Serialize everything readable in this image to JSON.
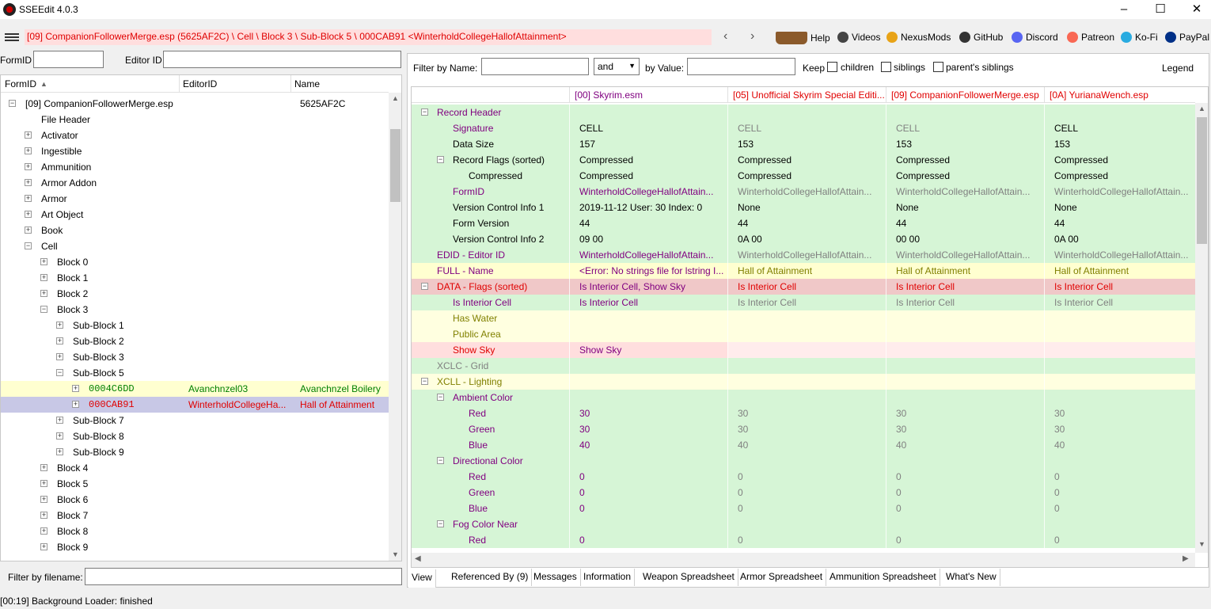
{
  "window": {
    "title": "SSEEdit 4.0.3",
    "minimize": "–",
    "maximize": "☐",
    "close": "✕"
  },
  "toolbar": {
    "path": "[09] CompanionFollowerMerge.esp (5625AF2C) \\ Cell \\ Block 3 \\ Sub-Block 5 \\ 000CAB91 <WinterholdCollegeHallofAttainment>",
    "back": "‹",
    "forward": "›",
    "links": [
      {
        "label": "Help",
        "icon": "book-icon"
      },
      {
        "label": "Videos",
        "icon": "gp-icon"
      },
      {
        "label": "NexusMods",
        "icon": "nexus-icon"
      },
      {
        "label": "GitHub",
        "icon": "github-icon"
      },
      {
        "label": "Discord",
        "icon": "discord-icon"
      },
      {
        "label": "Patreon",
        "icon": "patreon-icon"
      },
      {
        "label": "Ko-Fi",
        "icon": "kofi-icon"
      },
      {
        "label": "PayPal",
        "icon": "paypal-icon"
      }
    ]
  },
  "left": {
    "formid_label": "FormID",
    "editorid_label": "Editor ID",
    "formid_value": "",
    "editorid_value": "",
    "columns": [
      "FormID",
      "EditorID",
      "Name"
    ],
    "sort_indicator": "▲",
    "plugin": {
      "name": "[09] CompanionFollowerMerge.esp",
      "crc": "5625AF2C"
    },
    "tree": [
      {
        "indent": 1,
        "exp": "",
        "text": "File Header"
      },
      {
        "indent": 1,
        "exp": "+",
        "text": "Activator"
      },
      {
        "indent": 1,
        "exp": "+",
        "text": "Ingestible"
      },
      {
        "indent": 1,
        "exp": "+",
        "text": "Ammunition"
      },
      {
        "indent": 1,
        "exp": "+",
        "text": "Armor Addon"
      },
      {
        "indent": 1,
        "exp": "+",
        "text": "Armor"
      },
      {
        "indent": 1,
        "exp": "+",
        "text": "Art Object"
      },
      {
        "indent": 1,
        "exp": "+",
        "text": "Book"
      },
      {
        "indent": 1,
        "exp": "−",
        "text": "Cell"
      },
      {
        "indent": 2,
        "exp": "+",
        "text": "Block 0"
      },
      {
        "indent": 2,
        "exp": "+",
        "text": "Block 1"
      },
      {
        "indent": 2,
        "exp": "+",
        "text": "Block 2"
      },
      {
        "indent": 2,
        "exp": "−",
        "text": "Block 3"
      },
      {
        "indent": 3,
        "exp": "+",
        "text": "Sub-Block 1"
      },
      {
        "indent": 3,
        "exp": "+",
        "text": "Sub-Block 2"
      },
      {
        "indent": 3,
        "exp": "+",
        "text": "Sub-Block 3"
      },
      {
        "indent": 3,
        "exp": "−",
        "text": "Sub-Block 5"
      },
      {
        "indent": 4,
        "exp": "+",
        "text": "0004C6DD",
        "editorid": "Avanchnzel03",
        "name": "Avanchnzel Boilery",
        "style": "green"
      },
      {
        "indent": 4,
        "exp": "+",
        "text": "000CAB91",
        "editorid": "WinterholdCollegeHa...",
        "name": "Hall of Attainment",
        "style": "selected"
      },
      {
        "indent": 3,
        "exp": "+",
        "text": "Sub-Block 7"
      },
      {
        "indent": 3,
        "exp": "+",
        "text": "Sub-Block 8"
      },
      {
        "indent": 3,
        "exp": "+",
        "text": "Sub-Block 9"
      },
      {
        "indent": 2,
        "exp": "+",
        "text": "Block 4"
      },
      {
        "indent": 2,
        "exp": "+",
        "text": "Block 5"
      },
      {
        "indent": 2,
        "exp": "+",
        "text": "Block 6"
      },
      {
        "indent": 2,
        "exp": "+",
        "text": "Block 7"
      },
      {
        "indent": 2,
        "exp": "+",
        "text": "Block 8"
      },
      {
        "indent": 2,
        "exp": "+",
        "text": "Block 9"
      }
    ],
    "filter_label": "Filter by filename:",
    "filter_value": ""
  },
  "right": {
    "filter_name_label": "Filter by Name:",
    "filter_name_value": "",
    "and_value": "and",
    "by_value_label": "by Value:",
    "by_value_value": "",
    "keep_label": "Keep",
    "children_label": "children",
    "siblings_label": "siblings",
    "parents_siblings_label": "parent's siblings",
    "legend_label": "Legend",
    "plugins": [
      "[00] Skyrim.esm",
      "[05] Unofficial Skyrim Special Editi...",
      "[09] CompanionFollowerMerge.esp",
      "[0A] YurianaWench.esp"
    ],
    "rows": [
      {
        "indent": 0,
        "exp": "−",
        "label": "Record Header",
        "bg": "green",
        "lc": "purple",
        "vals": [
          "",
          "",
          "",
          ""
        ],
        "vc": [
          "black",
          "black",
          "black",
          "black"
        ]
      },
      {
        "indent": 1,
        "exp": "",
        "label": "Signature",
        "bg": "green",
        "lc": "purple",
        "vals": [
          "CELL",
          "CELL",
          "CELL",
          "CELL"
        ],
        "vc": [
          "black",
          "gray",
          "gray",
          "black"
        ]
      },
      {
        "indent": 1,
        "exp": "",
        "label": "Data Size",
        "bg": "green",
        "lc": "black",
        "vals": [
          "157",
          "153",
          "153",
          "153"
        ],
        "vc": [
          "black",
          "black",
          "black",
          "black"
        ]
      },
      {
        "indent": 1,
        "exp": "−",
        "label": "Record Flags (sorted)",
        "bg": "green",
        "lc": "black",
        "vals": [
          "Compressed",
          "Compressed",
          "Compressed",
          "Compressed"
        ],
        "vc": [
          "black",
          "black",
          "black",
          "black"
        ]
      },
      {
        "indent": 2,
        "exp": "",
        "label": "Compressed",
        "bg": "green",
        "lc": "black",
        "vals": [
          "Compressed",
          "Compressed",
          "Compressed",
          "Compressed"
        ],
        "vc": [
          "black",
          "black",
          "black",
          "black"
        ]
      },
      {
        "indent": 1,
        "exp": "",
        "label": "FormID",
        "bg": "green",
        "lc": "purple",
        "vals": [
          "WinterholdCollegeHallofAttain...",
          "WinterholdCollegeHallofAttain...",
          "WinterholdCollegeHallofAttain...",
          "WinterholdCollegeHallofAttain..."
        ],
        "vc": [
          "purple",
          "gray",
          "gray",
          "gray"
        ]
      },
      {
        "indent": 1,
        "exp": "",
        "label": "Version Control Info 1",
        "bg": "green",
        "lc": "black",
        "vals": [
          "2019-11-12 User: 30 Index: 0",
          "None",
          "None",
          "None"
        ],
        "vc": [
          "black",
          "black",
          "black",
          "black"
        ]
      },
      {
        "indent": 1,
        "exp": "",
        "label": "Form Version",
        "bg": "green",
        "lc": "black",
        "vals": [
          "44",
          "44",
          "44",
          "44"
        ],
        "vc": [
          "black",
          "black",
          "black",
          "black"
        ]
      },
      {
        "indent": 1,
        "exp": "",
        "label": "Version Control Info 2",
        "bg": "green",
        "lc": "black",
        "vals": [
          "09 00",
          "0A 00",
          "00 00",
          "0A 00"
        ],
        "vc": [
          "black",
          "black",
          "black",
          "black"
        ]
      },
      {
        "indent": 0,
        "exp": "",
        "label": "EDID - Editor ID",
        "bg": "green",
        "lc": "purple",
        "vals": [
          "WinterholdCollegeHallofAttain...",
          "WinterholdCollegeHallofAttain...",
          "WinterholdCollegeHallofAttain...",
          "WinterholdCollegeHallofAttain..."
        ],
        "vc": [
          "purple",
          "gray",
          "gray",
          "gray"
        ]
      },
      {
        "indent": 0,
        "exp": "",
        "label": "FULL - Name",
        "bg": "yellow",
        "lc": "purple",
        "vals": [
          "<Error: No strings file for lstring I...",
          "Hall of Attainment",
          "Hall of Attainment",
          "Hall of Attainment"
        ],
        "vc": [
          "purple",
          "olive",
          "olive",
          "olive"
        ]
      },
      {
        "indent": 0,
        "exp": "−",
        "label": "DATA - Flags (sorted)",
        "bg": "red",
        "lc": "red",
        "vals": [
          "Is Interior Cell, Show Sky",
          "Is Interior Cell",
          "Is Interior Cell",
          "Is Interior Cell"
        ],
        "vc": [
          "purple",
          "red",
          "red",
          "red"
        ]
      },
      {
        "indent": 1,
        "exp": "",
        "label": "Is Interior Cell",
        "bg": "green",
        "lc": "purple",
        "vals": [
          "Is Interior Cell",
          "Is Interior Cell",
          "Is Interior Cell",
          "Is Interior Cell"
        ],
        "vc": [
          "purple",
          "gray",
          "gray",
          "gray"
        ]
      },
      {
        "indent": 1,
        "exp": "",
        "label": "Has Water",
        "bg": "lightyellow",
        "lc": "olive",
        "vals": [
          "",
          "",
          "",
          ""
        ],
        "vc": [
          "black",
          "black",
          "black",
          "black"
        ]
      },
      {
        "indent": 1,
        "exp": "",
        "label": "Public Area",
        "bg": "lightyellow",
        "lc": "olive",
        "vals": [
          "",
          "",
          "",
          ""
        ],
        "vc": [
          "black",
          "black",
          "black",
          "black"
        ]
      },
      {
        "indent": 1,
        "exp": "",
        "label": "Show Sky",
        "bg": "pink",
        "lc": "red",
        "vals": [
          "Show Sky",
          "",
          "",
          ""
        ],
        "vc": [
          "purple",
          "black",
          "black",
          "black"
        ]
      },
      {
        "indent": 0,
        "exp": "",
        "label": "XCLC - Grid",
        "bg": "green",
        "lc": "gray",
        "vals": [
          "",
          "",
          "",
          ""
        ],
        "vc": [
          "black",
          "black",
          "black",
          "black"
        ]
      },
      {
        "indent": 0,
        "exp": "−",
        "label": "XCLL - Lighting",
        "bg": "lightyellow",
        "lc": "olive",
        "vals": [
          "",
          "",
          "",
          ""
        ],
        "vc": [
          "black",
          "black",
          "black",
          "black"
        ]
      },
      {
        "indent": 1,
        "exp": "−",
        "label": "Ambient Color",
        "bg": "green",
        "lc": "purple",
        "vals": [
          "",
          "",
          "",
          ""
        ],
        "vc": [
          "black",
          "black",
          "black",
          "black"
        ]
      },
      {
        "indent": 2,
        "exp": "",
        "label": "Red",
        "bg": "green",
        "lc": "purple",
        "vals": [
          "30",
          "30",
          "30",
          "30"
        ],
        "vc": [
          "purple",
          "gray",
          "gray",
          "gray"
        ]
      },
      {
        "indent": 2,
        "exp": "",
        "label": "Green",
        "bg": "green",
        "lc": "purple",
        "vals": [
          "30",
          "30",
          "30",
          "30"
        ],
        "vc": [
          "purple",
          "gray",
          "gray",
          "gray"
        ]
      },
      {
        "indent": 2,
        "exp": "",
        "label": "Blue",
        "bg": "green",
        "lc": "purple",
        "vals": [
          "40",
          "40",
          "40",
          "40"
        ],
        "vc": [
          "purple",
          "gray",
          "gray",
          "gray"
        ]
      },
      {
        "indent": 1,
        "exp": "−",
        "label": "Directional Color",
        "bg": "green",
        "lc": "purple",
        "vals": [
          "",
          "",
          "",
          ""
        ],
        "vc": [
          "black",
          "black",
          "black",
          "black"
        ]
      },
      {
        "indent": 2,
        "exp": "",
        "label": "Red",
        "bg": "green",
        "lc": "purple",
        "vals": [
          "0",
          "0",
          "0",
          "0"
        ],
        "vc": [
          "purple",
          "gray",
          "gray",
          "gray"
        ]
      },
      {
        "indent": 2,
        "exp": "",
        "label": "Green",
        "bg": "green",
        "lc": "purple",
        "vals": [
          "0",
          "0",
          "0",
          "0"
        ],
        "vc": [
          "purple",
          "gray",
          "gray",
          "gray"
        ]
      },
      {
        "indent": 2,
        "exp": "",
        "label": "Blue",
        "bg": "green",
        "lc": "purple",
        "vals": [
          "0",
          "0",
          "0",
          "0"
        ],
        "vc": [
          "purple",
          "gray",
          "gray",
          "gray"
        ]
      },
      {
        "indent": 1,
        "exp": "−",
        "label": "Fog Color Near",
        "bg": "green",
        "lc": "purple",
        "vals": [
          "",
          "",
          "",
          ""
        ],
        "vc": [
          "black",
          "black",
          "black",
          "black"
        ]
      },
      {
        "indent": 2,
        "exp": "",
        "label": "Red",
        "bg": "green",
        "lc": "purple",
        "vals": [
          "0",
          "0",
          "0",
          "0"
        ],
        "vc": [
          "purple",
          "gray",
          "gray",
          "gray"
        ]
      }
    ],
    "tabs": [
      "View",
      "Referenced By (9)",
      "Messages",
      "Information",
      "Weapon Spreadsheet",
      "Armor Spreadsheet",
      "Ammunition Spreadsheet",
      "What's New"
    ],
    "active_tab": 0
  },
  "status": "[00:19] Background Loader: finished",
  "colors": {
    "green": "#d6f5d6",
    "yellow": "#ffffd0",
    "lightyellow": "#ffffe0",
    "red": "#f0c8c8",
    "pink": "#ffdede",
    "selected": "#c8c8e6",
    "greenrow": "#ffffd0",
    "purple": "#800080",
    "black": "#000000",
    "gray": "#808080",
    "olive": "#808000",
    "redtext": "#e00000"
  }
}
